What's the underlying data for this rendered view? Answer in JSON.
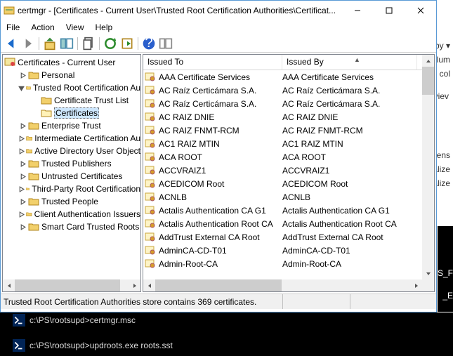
{
  "window": {
    "title": "certmgr - [Certificates - Current User\\Trusted Root Certification Authorities\\Certificat..."
  },
  "menu": {
    "file": "File",
    "action": "Action",
    "view": "View",
    "help": "Help"
  },
  "tree": {
    "root": "Certificates - Current User",
    "nodes": [
      {
        "label": "Personal",
        "expandable": true,
        "depth": 1
      },
      {
        "label": "Trusted Root Certification Au",
        "expandable": true,
        "expanded": true,
        "depth": 1
      },
      {
        "label": "Certificate Trust List",
        "expandable": false,
        "depth": 2
      },
      {
        "label": "Certificates",
        "expandable": false,
        "depth": 2,
        "selected": true
      },
      {
        "label": "Enterprise Trust",
        "expandable": true,
        "depth": 1
      },
      {
        "label": "Intermediate Certification Au",
        "expandable": true,
        "depth": 1
      },
      {
        "label": "Active Directory User Object",
        "expandable": true,
        "depth": 1
      },
      {
        "label": "Trusted Publishers",
        "expandable": true,
        "depth": 1
      },
      {
        "label": "Untrusted Certificates",
        "expandable": true,
        "depth": 1
      },
      {
        "label": "Third-Party Root Certification",
        "expandable": true,
        "depth": 1
      },
      {
        "label": "Trusted People",
        "expandable": true,
        "depth": 1
      },
      {
        "label": "Client Authentication Issuers",
        "expandable": true,
        "depth": 1
      },
      {
        "label": "Smart Card Trusted Roots",
        "expandable": true,
        "depth": 1
      }
    ]
  },
  "list": {
    "headers": {
      "col1": "Issued To",
      "col2": "Issued By"
    },
    "rows": [
      {
        "to": "AAA Certificate Services",
        "by": "AAA Certificate Services"
      },
      {
        "to": "AC Raíz Certicámara S.A.",
        "by": "AC Raíz Certicámara S.A."
      },
      {
        "to": "AC Raíz Certicámara S.A.",
        "by": "AC Raíz Certicámara S.A."
      },
      {
        "to": "AC RAIZ DNIE",
        "by": "AC RAIZ DNIE"
      },
      {
        "to": "AC RAIZ FNMT-RCM",
        "by": "AC RAIZ FNMT-RCM"
      },
      {
        "to": "AC1 RAIZ MTIN",
        "by": "AC1 RAIZ MTIN"
      },
      {
        "to": "ACA ROOT",
        "by": "ACA ROOT"
      },
      {
        "to": "ACCVRAIZ1",
        "by": "ACCVRAIZ1"
      },
      {
        "to": "ACEDICOM Root",
        "by": "ACEDICOM Root"
      },
      {
        "to": "ACNLB",
        "by": "ACNLB"
      },
      {
        "to": "Actalis Authentication CA G1",
        "by": "Actalis Authentication CA G1"
      },
      {
        "to": "Actalis Authentication Root CA",
        "by": "Actalis Authentication Root CA"
      },
      {
        "to": "AddTrust External CA Root",
        "by": "AddTrust External CA Root"
      },
      {
        "to": "AdminCA-CD-T01",
        "by": "AdminCA-CD-T01"
      },
      {
        "to": "Admin-Root-CA",
        "by": "Admin-Root-CA"
      }
    ]
  },
  "status": "Trusted Root Certification Authorities store contains 369 certificates.",
  "bg": {
    "t1": "by ▾",
    "t2": "lum",
    "t3": "col",
    "t4": "viev",
    "t5": "tens",
    "t6": "alize",
    "t7": "alize"
  },
  "blackright": {
    "a": "S_F",
    "b": "_E"
  },
  "console": {
    "line1_prompt": "c:\\PS\\rootsupd>",
    "line1_cmd": "certmgr.msc",
    "line2_prompt": "c:\\PS\\rootsupd>",
    "line2_cmd": "updroots.exe roots.sst"
  }
}
